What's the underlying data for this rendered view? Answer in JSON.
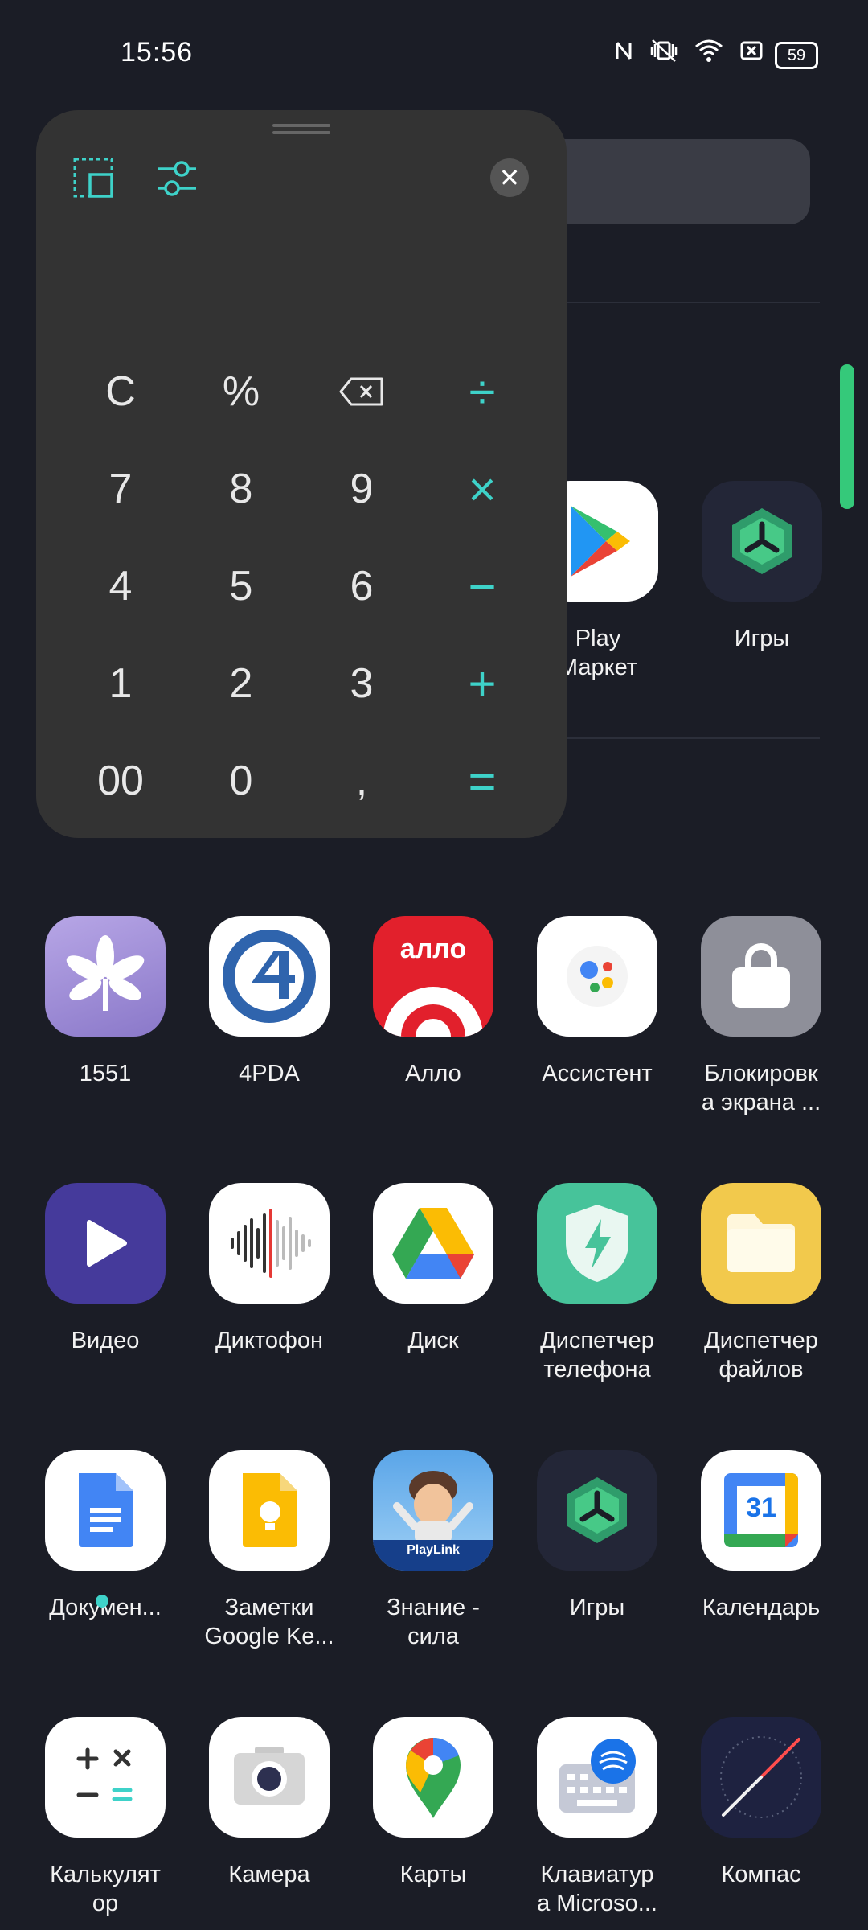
{
  "status_bar": {
    "time": "15:56",
    "battery": "59"
  },
  "calculator": {
    "keys": [
      [
        "C",
        "%",
        "backspace",
        "÷"
      ],
      [
        "7",
        "8",
        "9",
        "×"
      ],
      [
        "4",
        "5",
        "6",
        "−"
      ],
      [
        "1",
        "2",
        "3",
        "+"
      ],
      [
        "00",
        "0",
        ",",
        "="
      ]
    ]
  },
  "partial_apps": {
    "play": "Play\nМаркет",
    "games_top": "Игры"
  },
  "apps": [
    {
      "label": "1551"
    },
    {
      "label": "4PDA"
    },
    {
      "label": "Алло"
    },
    {
      "label": "Ассистент"
    },
    {
      "label": "Блокировк\nа экрана ..."
    },
    {
      "label": "Видео"
    },
    {
      "label": "Диктофон"
    },
    {
      "label": "Диск"
    },
    {
      "label": "Диспетчер\nтелефона"
    },
    {
      "label": "Диспетчер\nфайлов"
    },
    {
      "label": "Докумен..."
    },
    {
      "label": "Заметки\nGoogle Ke..."
    },
    {
      "label": "Знание -\nсила"
    },
    {
      "label": "Игры"
    },
    {
      "label": "Календарь"
    },
    {
      "label": "Калькулят\nор"
    },
    {
      "label": "Камера"
    },
    {
      "label": "Карты"
    },
    {
      "label": "Клавиатур\nа Microso..."
    },
    {
      "label": "Компас"
    }
  ],
  "icon_texts": {
    "allo": "алло",
    "calendar": "31",
    "playlink": "PlayLink"
  },
  "colors": {
    "accent": "#3ed2c9",
    "background": "#1b1d26",
    "panel": "#333333",
    "scroll": "#35c97a"
  }
}
